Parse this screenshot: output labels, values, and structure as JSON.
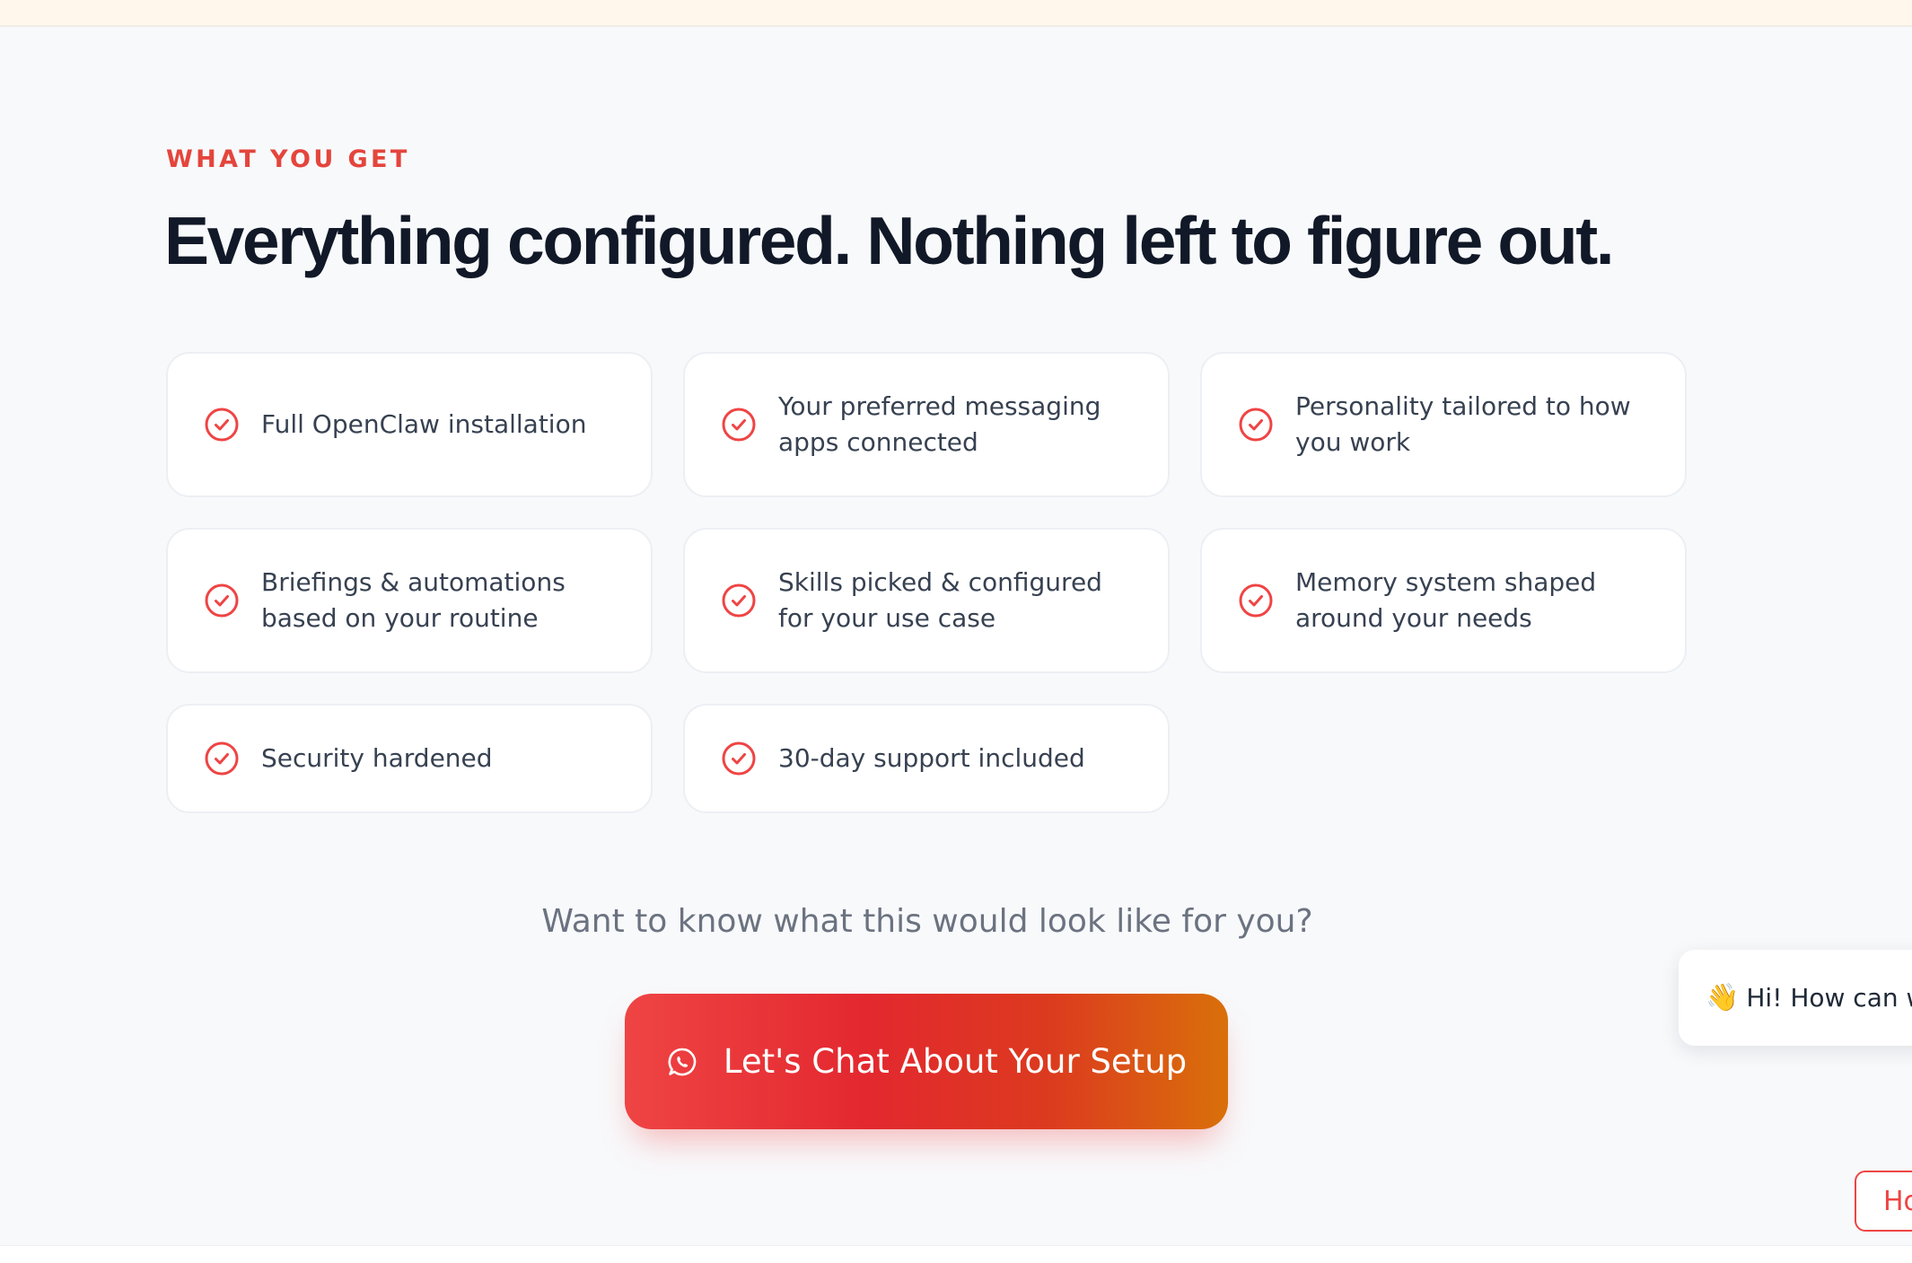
{
  "section": {
    "eyebrow": "WHAT YOU GET",
    "headline": "Everything configured. Nothing left to figure out."
  },
  "features": [
    {
      "icon": "check-circle-icon",
      "label": "Full OpenClaw installation"
    },
    {
      "icon": "check-circle-icon",
      "label": "Your preferred messaging apps connected"
    },
    {
      "icon": "check-circle-icon",
      "label": "Personality tailored to how you work"
    },
    {
      "icon": "check-circle-icon",
      "label": "Briefings & automations based on your routine"
    },
    {
      "icon": "check-circle-icon",
      "label": "Skills picked & configured for your use case"
    },
    {
      "icon": "check-circle-icon",
      "label": "Memory system shaped around your needs"
    },
    {
      "icon": "check-circle-icon",
      "label": "Security hardened"
    },
    {
      "icon": "check-circle-icon",
      "label": "30-day support included"
    }
  ],
  "cta": {
    "question": "Want to know what this would look like for you?",
    "button_label": "Let's Chat About Your Setup",
    "button_icon": "whatsapp-icon"
  },
  "chat_widget": {
    "bubble_icon": "waving-hand-icon",
    "bubble_text": "Hi! How can we",
    "help_button_label": "Ho"
  },
  "colors": {
    "accent": "#ef4444",
    "accent_end": "#d9700a",
    "headline": "#111827",
    "body_text": "#374151",
    "muted_text": "#6b7280",
    "page_background": "#f8f9fb",
    "card_background": "#ffffff"
  }
}
